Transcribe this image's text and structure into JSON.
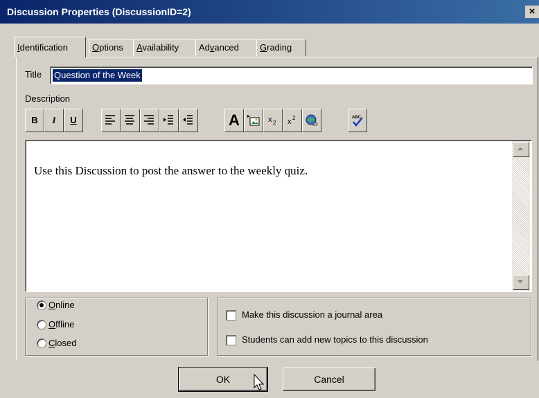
{
  "window": {
    "title": "Discussion Properties (DiscussionID=2)",
    "close_glyph": "×"
  },
  "tabs": [
    {
      "label": "Identification",
      "access": "I",
      "rest": "dentification"
    },
    {
      "label": "Options",
      "access": "O",
      "rest": "ptions"
    },
    {
      "label": "Availability",
      "access": "A",
      "rest": "vailability"
    },
    {
      "label": "Advanced",
      "pre": "Ad",
      "access": "v",
      "rest": "anced"
    },
    {
      "label": "Grading",
      "access": "G",
      "rest": "rading"
    }
  ],
  "form": {
    "title_label": "Title",
    "title_value": "Question of the Week",
    "description_label": "Description"
  },
  "toolbar": {
    "bold": "B",
    "italic": "I",
    "underline": "U",
    "font": "A",
    "icons": [
      "bold-icon",
      "italic-icon",
      "underline-icon",
      "align-left-icon",
      "align-center-icon",
      "align-right-icon",
      "indent-icon",
      "outdent-icon",
      "font-icon",
      "insert-image-icon",
      "subscript-icon",
      "superscript-icon",
      "insert-link-icon",
      "spellcheck-icon"
    ]
  },
  "editor": {
    "content": "Use this Discussion to post the answer to the weekly quiz."
  },
  "status": {
    "options": [
      {
        "access": "O",
        "rest": "nline",
        "label": "Online",
        "checked": true
      },
      {
        "access": "O",
        "rest": "ffline",
        "label": "Offline",
        "checked": false
      },
      {
        "access": "C",
        "rest": "losed",
        "label": "Closed",
        "checked": false
      }
    ]
  },
  "settings": {
    "journal_label": "Make this discussion a journal area",
    "journal_checked": false,
    "topics_label": "Students can add new topics to this discussion",
    "topics_checked": false
  },
  "buttons": {
    "ok": "OK",
    "cancel": "Cancel"
  }
}
